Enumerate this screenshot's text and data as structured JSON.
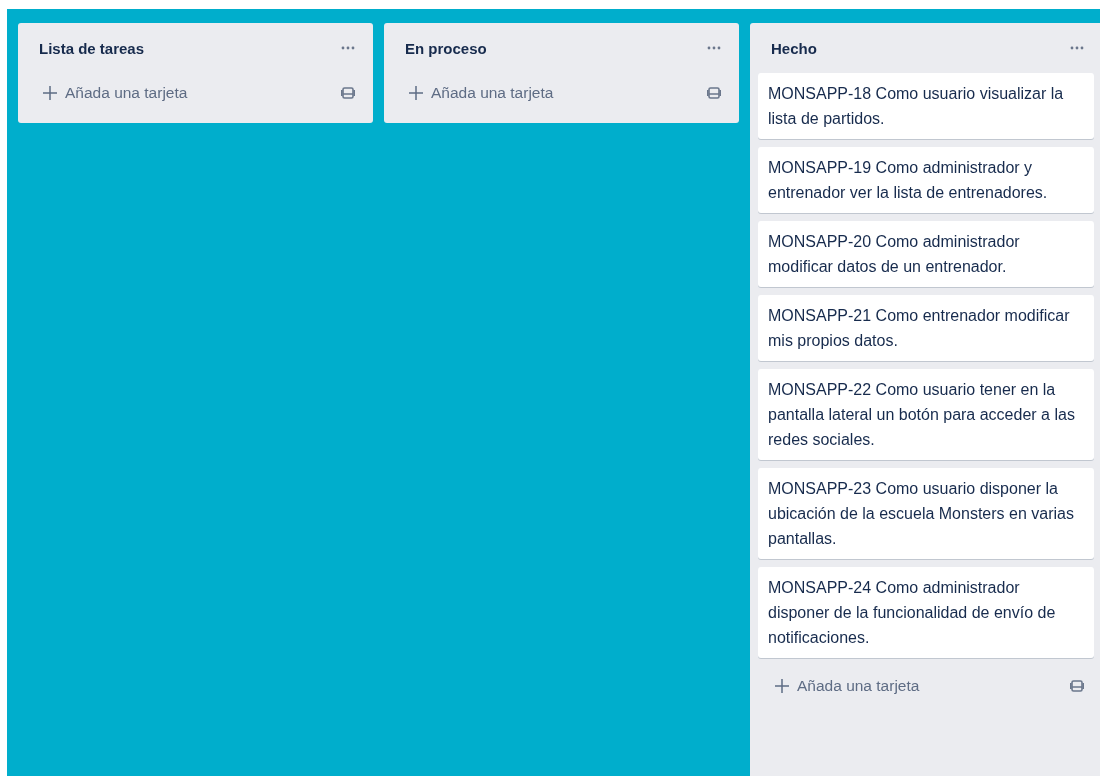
{
  "lists": [
    {
      "title": "Lista de tareas",
      "add_label": "Añada una tarjeta"
    },
    {
      "title": "En proceso",
      "add_label": "Añada una tarjeta"
    },
    {
      "title": "Hecho",
      "cards": [
        "MONSAPP-18 Como usuario visualizar la lista de partidos.",
        "MONSAPP-19 Como administrador y entrenador ver la lista de entrenadores.",
        "MONSAPP-20 Como administrador modificar datos de un entrenador.",
        "MONSAPP-21 Como entrenador modificar mis propios datos.",
        "MONSAPP-22 Como usuario tener en la pantalla lateral un botón para acceder a las redes sociales.",
        "MONSAPP-23 Como usuario disponer la ubicación de la escuela Monsters en varias pantallas.",
        "MONSAPP-24 Como administrador disponer de la funcionalidad de envío de notificaciones."
      ],
      "add_label": "Añada una tarjeta"
    }
  ]
}
